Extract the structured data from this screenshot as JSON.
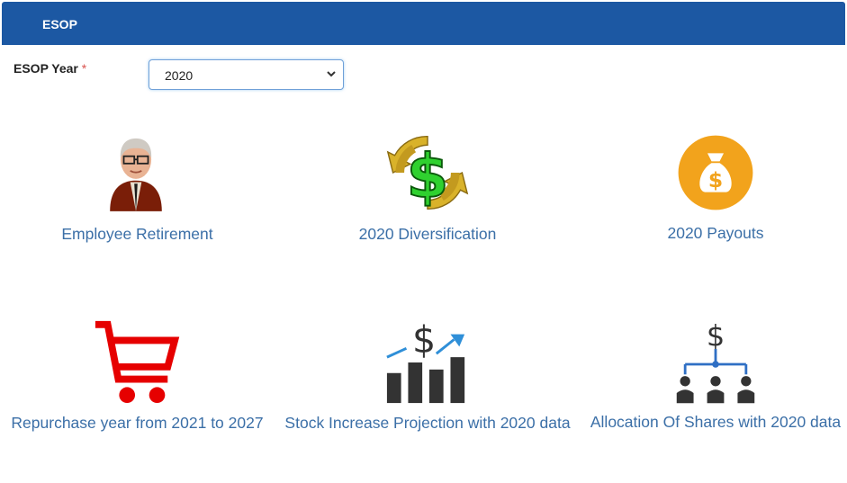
{
  "header": {
    "title": "ESOP"
  },
  "year_filter": {
    "label": "ESOP Year",
    "required_mark": "*",
    "selected": "2020"
  },
  "tiles": [
    {
      "label": "Employee Retirement",
      "icon": "retiree-avatar-icon"
    },
    {
      "label": "2020 Diversification",
      "icon": "dollar-cycle-icon"
    },
    {
      "label": "2020 Payouts",
      "icon": "money-bag-icon"
    },
    {
      "label": "Repurchase year from 2021 to 2027",
      "icon": "shopping-cart-icon"
    },
    {
      "label": "Stock Increase Projection with 2020 data",
      "icon": "dollar-growth-chart-icon"
    },
    {
      "label": "Allocation Of Shares with 2020 data",
      "icon": "share-allocation-icon"
    }
  ],
  "colors": {
    "header_bg": "#1c58a3",
    "link": "#3b6fa7",
    "payout_circle": "#f2a31c",
    "cart": "#e60000"
  }
}
